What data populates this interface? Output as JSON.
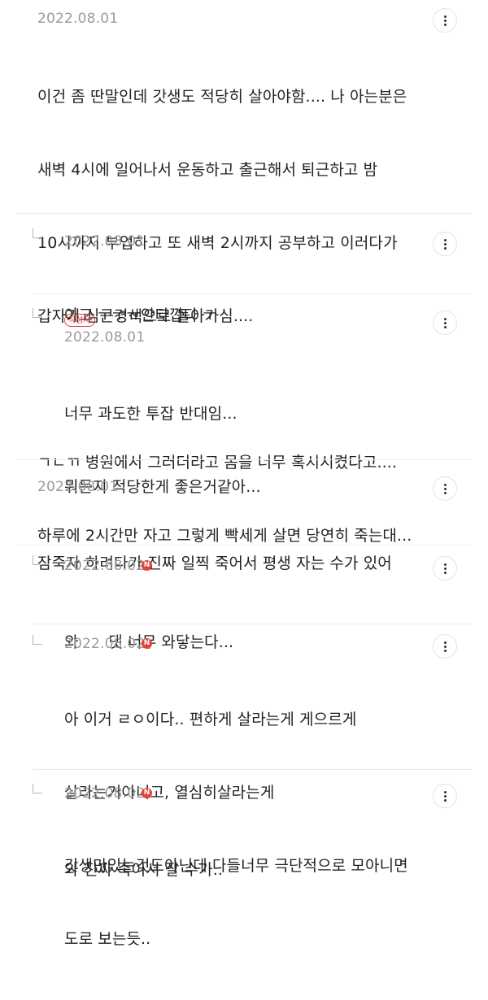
{
  "comments": [
    {
      "date": "2022.08.01",
      "lines": [
        "이건 좀 딴말인데 갓생도 적당히 살아야함.... 나 아는분은",
        "새벽 4시에 일어나서 운동하고 출근해서 퇴근하고 밤",
        "10시까지 부업하고 또 새벽 2시까지 공부하고 이러다가",
        "갑자기 심근경색으로 돌아가심....",
        "",
        "ㄱㄴㄲ 병원에서 그러더라고 몸을 너무 혹시시켰다고....",
        "하루에 2시간만 자고 그렇게 빡세게 살면 당연히 죽는대..."
      ]
    },
    {
      "date": "2022.08.01",
      "lines": [
        "아고 ㅜㅜㅠ안타깝다 ㅜ"
      ]
    },
    {
      "author_badge": "작성자",
      "date": "2022.08.01",
      "lines": [
        "너무 과도한 투잡 반대임...",
        "뭐든지 적당한게 좋은거같아..."
      ]
    },
    {
      "date": "2022.08.01",
      "lines": [
        "잠죽자 하려다가 진짜 일찍 죽어서 평생 자는 수가 있어"
      ]
    },
    {
      "date": "2022.08.02",
      "new_badge": "N",
      "lines": [
        "와      댓 너무 와닿는다..."
      ]
    },
    {
      "date": "2022.08.02",
      "new_badge": "N",
      "lines": [
        "아 이거 ㄹㅇ이다.. 편하게 살라는게 게으르게",
        "살라는거아니고, 열심히살라는게",
        "갓생만있는것도아닌데 다들너무 극단적으로 모아니면",
        "도로 보는듯.."
      ]
    },
    {
      "date": "2022.08.02",
      "new_badge": "N",
      "lines": [
        "와 진짜 죽어서 잘 수가.."
      ]
    }
  ]
}
